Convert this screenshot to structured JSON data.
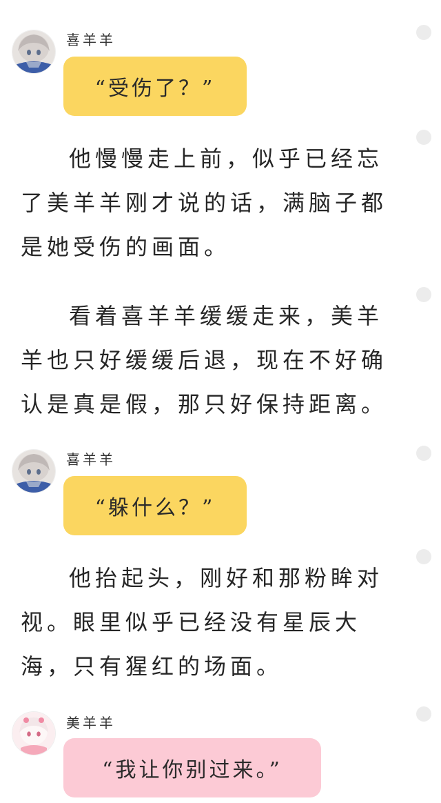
{
  "blocks": [
    {
      "type": "dialogue",
      "speaker": "喜羊羊",
      "text": "“受伤了？”",
      "color": "yellow"
    },
    {
      "type": "narration",
      "text": "他慢慢走上前，似乎已经忘了美羊羊刚才说的话，满脑子都是她受伤的画面。"
    },
    {
      "type": "narration",
      "text": "看着喜羊羊缓缓走来，美羊羊也只好缓缓后退，现在不好确认是真是假，那只好保持距离。"
    },
    {
      "type": "dialogue",
      "speaker": "喜羊羊",
      "text": "“躲什么？”",
      "color": "yellow"
    },
    {
      "type": "narration",
      "text": "他抬起头，刚好和那粉眸对视。眼里似乎已经没有星辰大海，只有猩红的场面。"
    },
    {
      "type": "dialogue",
      "speaker": "美羊羊",
      "text": "“我让你别过来。”",
      "color": "pink"
    }
  ],
  "colors": {
    "yellow_bubble": "#fbd660",
    "pink_bubble": "#fccad5",
    "side_dot": "#ececec"
  },
  "icons": [
    "avatar-xiyangyang",
    "avatar-meiyangyang",
    "comment-dot"
  ]
}
